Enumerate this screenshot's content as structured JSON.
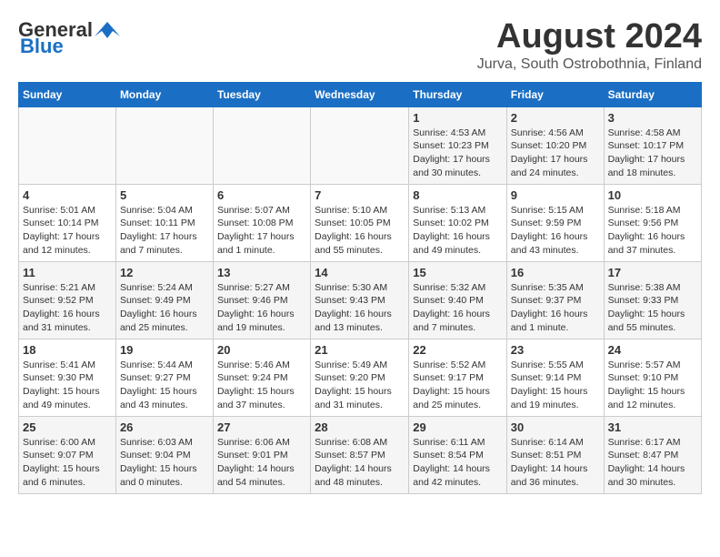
{
  "header": {
    "logo_general": "General",
    "logo_blue": "Blue",
    "month_title": "August 2024",
    "location": "Jurva, South Ostrobothnia, Finland"
  },
  "weekdays": [
    "Sunday",
    "Monday",
    "Tuesday",
    "Wednesday",
    "Thursday",
    "Friday",
    "Saturday"
  ],
  "weeks": [
    [
      {
        "day": "",
        "info": ""
      },
      {
        "day": "",
        "info": ""
      },
      {
        "day": "",
        "info": ""
      },
      {
        "day": "",
        "info": ""
      },
      {
        "day": "1",
        "info": "Sunrise: 4:53 AM\nSunset: 10:23 PM\nDaylight: 17 hours\nand 30 minutes."
      },
      {
        "day": "2",
        "info": "Sunrise: 4:56 AM\nSunset: 10:20 PM\nDaylight: 17 hours\nand 24 minutes."
      },
      {
        "day": "3",
        "info": "Sunrise: 4:58 AM\nSunset: 10:17 PM\nDaylight: 17 hours\nand 18 minutes."
      }
    ],
    [
      {
        "day": "4",
        "info": "Sunrise: 5:01 AM\nSunset: 10:14 PM\nDaylight: 17 hours\nand 12 minutes."
      },
      {
        "day": "5",
        "info": "Sunrise: 5:04 AM\nSunset: 10:11 PM\nDaylight: 17 hours\nand 7 minutes."
      },
      {
        "day": "6",
        "info": "Sunrise: 5:07 AM\nSunset: 10:08 PM\nDaylight: 17 hours\nand 1 minute."
      },
      {
        "day": "7",
        "info": "Sunrise: 5:10 AM\nSunset: 10:05 PM\nDaylight: 16 hours\nand 55 minutes."
      },
      {
        "day": "8",
        "info": "Sunrise: 5:13 AM\nSunset: 10:02 PM\nDaylight: 16 hours\nand 49 minutes."
      },
      {
        "day": "9",
        "info": "Sunrise: 5:15 AM\nSunset: 9:59 PM\nDaylight: 16 hours\nand 43 minutes."
      },
      {
        "day": "10",
        "info": "Sunrise: 5:18 AM\nSunset: 9:56 PM\nDaylight: 16 hours\nand 37 minutes."
      }
    ],
    [
      {
        "day": "11",
        "info": "Sunrise: 5:21 AM\nSunset: 9:52 PM\nDaylight: 16 hours\nand 31 minutes."
      },
      {
        "day": "12",
        "info": "Sunrise: 5:24 AM\nSunset: 9:49 PM\nDaylight: 16 hours\nand 25 minutes."
      },
      {
        "day": "13",
        "info": "Sunrise: 5:27 AM\nSunset: 9:46 PM\nDaylight: 16 hours\nand 19 minutes."
      },
      {
        "day": "14",
        "info": "Sunrise: 5:30 AM\nSunset: 9:43 PM\nDaylight: 16 hours\nand 13 minutes."
      },
      {
        "day": "15",
        "info": "Sunrise: 5:32 AM\nSunset: 9:40 PM\nDaylight: 16 hours\nand 7 minutes."
      },
      {
        "day": "16",
        "info": "Sunrise: 5:35 AM\nSunset: 9:37 PM\nDaylight: 16 hours\nand 1 minute."
      },
      {
        "day": "17",
        "info": "Sunrise: 5:38 AM\nSunset: 9:33 PM\nDaylight: 15 hours\nand 55 minutes."
      }
    ],
    [
      {
        "day": "18",
        "info": "Sunrise: 5:41 AM\nSunset: 9:30 PM\nDaylight: 15 hours\nand 49 minutes."
      },
      {
        "day": "19",
        "info": "Sunrise: 5:44 AM\nSunset: 9:27 PM\nDaylight: 15 hours\nand 43 minutes."
      },
      {
        "day": "20",
        "info": "Sunrise: 5:46 AM\nSunset: 9:24 PM\nDaylight: 15 hours\nand 37 minutes."
      },
      {
        "day": "21",
        "info": "Sunrise: 5:49 AM\nSunset: 9:20 PM\nDaylight: 15 hours\nand 31 minutes."
      },
      {
        "day": "22",
        "info": "Sunrise: 5:52 AM\nSunset: 9:17 PM\nDaylight: 15 hours\nand 25 minutes."
      },
      {
        "day": "23",
        "info": "Sunrise: 5:55 AM\nSunset: 9:14 PM\nDaylight: 15 hours\nand 19 minutes."
      },
      {
        "day": "24",
        "info": "Sunrise: 5:57 AM\nSunset: 9:10 PM\nDaylight: 15 hours\nand 12 minutes."
      }
    ],
    [
      {
        "day": "25",
        "info": "Sunrise: 6:00 AM\nSunset: 9:07 PM\nDaylight: 15 hours\nand 6 minutes."
      },
      {
        "day": "26",
        "info": "Sunrise: 6:03 AM\nSunset: 9:04 PM\nDaylight: 15 hours\nand 0 minutes."
      },
      {
        "day": "27",
        "info": "Sunrise: 6:06 AM\nSunset: 9:01 PM\nDaylight: 14 hours\nand 54 minutes."
      },
      {
        "day": "28",
        "info": "Sunrise: 6:08 AM\nSunset: 8:57 PM\nDaylight: 14 hours\nand 48 minutes."
      },
      {
        "day": "29",
        "info": "Sunrise: 6:11 AM\nSunset: 8:54 PM\nDaylight: 14 hours\nand 42 minutes."
      },
      {
        "day": "30",
        "info": "Sunrise: 6:14 AM\nSunset: 8:51 PM\nDaylight: 14 hours\nand 36 minutes."
      },
      {
        "day": "31",
        "info": "Sunrise: 6:17 AM\nSunset: 8:47 PM\nDaylight: 14 hours\nand 30 minutes."
      }
    ]
  ]
}
